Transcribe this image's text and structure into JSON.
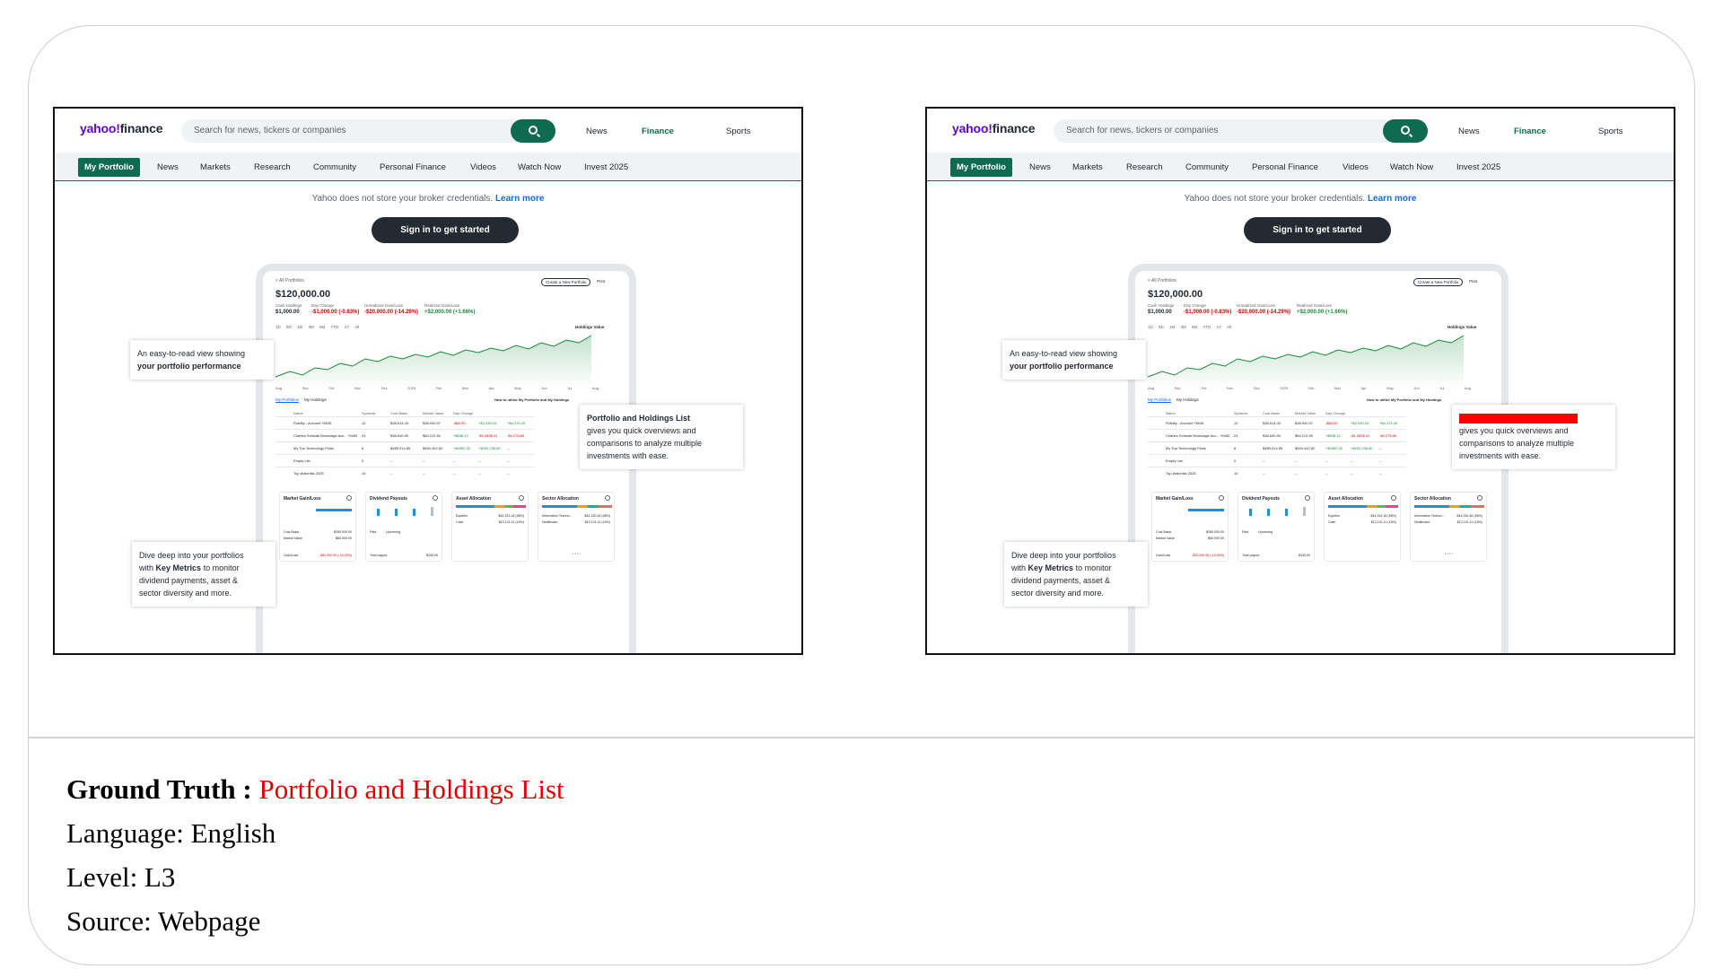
{
  "screenshots": [
    {
      "variant": "original"
    },
    {
      "variant": "masked"
    }
  ],
  "page": {
    "logo_main": "yahoo!",
    "logo_sub": "finance",
    "search_placeholder": "Search for news, tickers or companies",
    "top_links": [
      "News",
      "Finance",
      "Sports"
    ],
    "nav_items": [
      "My Portfolio",
      "News",
      "Markets",
      "Research",
      "Community",
      "Personal Finance",
      "Videos",
      "Watch Now",
      "Invest 2025"
    ],
    "notice": "Yahoo does not store your broker credentials.",
    "notice_link": "Learn more",
    "signin": "Sign in to get started"
  },
  "mock": {
    "all_portfolios": "< All Portfolios",
    "title": "$120,000.00",
    "create_btn": "Create a New Portfolio",
    "print_btn": "Print",
    "stats": [
      {
        "label": "Cash Holdings",
        "value": "$1,000.00"
      },
      {
        "label": "Day Change",
        "value": "-$1,000.00 (-0.83%)"
      },
      {
        "label": "Unrealized Gain/Loss",
        "value": "-$20,000.00 (-14.29%)"
      },
      {
        "label": "Realized Gain/Loss",
        "value": "+$2,000.00 (+1.66%)"
      }
    ],
    "ranges": "1D 5D 1M 3M 6M YTD 1Y All",
    "holdings_value": "Holdings Value",
    "months": [
      "Aug",
      "Sep",
      "Oct",
      "Nov",
      "Dec",
      "2025",
      "Feb",
      "Mar",
      "Apr",
      "May",
      "Jun",
      "Jul",
      "Aug"
    ],
    "tab1": "My Portfolios",
    "tab2": "My Holdings",
    "tab_help": "How to utilize My Portfolio and My Holdings",
    "table_head": [
      "Name",
      "Symbols",
      "Cost Basis",
      "Market Value",
      "Day Change",
      "Unrealized Gain/Loss",
      "Realized Gain/Loss"
    ],
    "table_rows": [
      [
        "Fidelity - Account *3845",
        "12",
        "$38,514.43",
        "$38,940.07",
        "-$60.90",
        "+$2,039.43",
        "+$4,074.49"
      ],
      [
        "Charles Schwab Brokerage Acc... *9483",
        "24",
        "$38,640.90",
        "$84,110.36",
        "+$638.12",
        "-$1,2838.41",
        "-$4,278.80"
      ],
      [
        "My Top Technology Picks",
        "6",
        "$485,014.85",
        "$494,442.82",
        "+$4950.32",
        "+$492,238.80",
        "--"
      ],
      [
        "Empty List",
        "0",
        "--",
        "--",
        "--",
        "--",
        "--"
      ],
      [
        "Top Watchlist 2025",
        "10",
        "--",
        "--",
        "--",
        "--",
        "--"
      ]
    ],
    "cards": [
      {
        "title": "Market Gain/Loss",
        "l1": "Cost Basis",
        "v1": "$280,000.00",
        "l2": "Market Value",
        "v2": "$80,000.00",
        "foot": "Gain/Loss",
        "foot_val": "-$20,000.00 (-14.00%)"
      },
      {
        "title": "Dividend Payouts",
        "l1": "Paid",
        "v1": "",
        "l2": "Upcoming",
        "v2": "",
        "foot": "Total payout",
        "foot_val": "$335.00"
      },
      {
        "title": "Asset Allocation",
        "l1": "Equities",
        "v1": "$44,333.18 (58%)",
        "l2": "Cash",
        "v2": "$13,131.11 (15%)",
        "foot": "",
        "foot_val": ""
      },
      {
        "title": "Sector Allocation",
        "l1": "Information Techno...",
        "v1": "$44,330.46 (58%)",
        "l2": "Healthcare",
        "v2": "$13,131.11 (15%)",
        "foot": "",
        "foot_val": ""
      }
    ]
  },
  "callouts": {
    "perf_line1": "An easy-to-read view showing",
    "perf_line2": "your portfolio performance",
    "holdings_title": "Portfolio and Holdings List",
    "holdings_body1": "gives you quick overviews and",
    "holdings_body2": "comparisons to analyze multiple",
    "holdings_body3": "investments with ease.",
    "metrics_line1": "Dive deep into your portfolios",
    "metrics_line2_pre": "with",
    "metrics_line2_bold": "Key Metrics",
    "metrics_line2_post": "to monitor",
    "metrics_line3": "dividend payments, asset &",
    "metrics_line4": "sector diversity and more."
  },
  "meta": {
    "ground_truth_label": "Ground Truth :",
    "ground_truth_value": "Portfolio and Holdings List",
    "language": "Language: English",
    "level": "Level: L3",
    "source": "Source: Webpage"
  },
  "colors": {
    "brand_green": "#0f6b4f",
    "logo_purple": "#5f01d1",
    "mask_red": "#ff0000",
    "gt_red": "#e00000"
  }
}
